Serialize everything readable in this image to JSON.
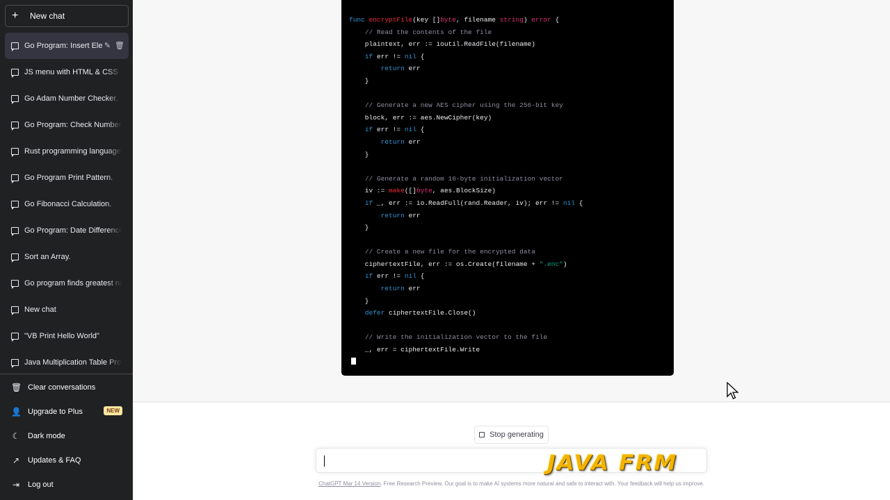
{
  "sidebar": {
    "new_chat": "New chat",
    "conversations": [
      {
        "title": "Go Program: Insert Ele",
        "active": true
      },
      {
        "title": "JS menu with HTML & CSS"
      },
      {
        "title": "Go Adam Number Checker."
      },
      {
        "title": "Go Program: Check Number"
      },
      {
        "title": "Rust programming language."
      },
      {
        "title": "Go Program Print Pattern."
      },
      {
        "title": "Go Fibonacci Calculation."
      },
      {
        "title": "Go Program: Date Difference."
      },
      {
        "title": "Sort an Array."
      },
      {
        "title": "Go program finds greatest nu"
      },
      {
        "title": "New chat"
      },
      {
        "title": "\"VB Print Hello World\""
      },
      {
        "title": "Java Multiplication Table Progr"
      }
    ],
    "bottom": {
      "clear": "Clear conversations",
      "upgrade": "Upgrade to Plus",
      "upgrade_badge": "NEW",
      "dark_mode": "Dark mode",
      "updates": "Updates & FAQ",
      "logout": "Log out"
    }
  },
  "code": {
    "language": "go",
    "lines": [
      "func encryptFile(key []byte, filename string) error {",
      "    // Read the contents of the file",
      "    plaintext, err := ioutil.ReadFile(filename)",
      "    if err != nil {",
      "        return err",
      "    }",
      "",
      "    // Generate a new AES cipher using the 256-bit key",
      "    block, err := aes.NewCipher(key)",
      "    if err != nil {",
      "        return err",
      "    }",
      "",
      "    // Generate a random 16-byte initialization vector",
      "    iv := make([]byte, aes.BlockSize)",
      "    if _, err := io.ReadFull(rand.Reader, iv); err != nil {",
      "        return err",
      "    }",
      "",
      "    // Create a new file for the encrypted data",
      "    ciphertextFile, err := os.Create(filename + \".enc\")",
      "    if err != nil {",
      "        return err",
      "    }",
      "    defer ciphertextFile.Close()",
      "",
      "    // Write the initialization vector to the file",
      "    _, err = ciphertextFile.Write"
    ]
  },
  "composer": {
    "stop_label": "Stop generating",
    "input_value": ""
  },
  "footer": {
    "version_link": "ChatGPT Mar 14 Version",
    "text": ". Free Research Preview. Our goal is to make AI systems more natural and safe to interact with. Your feedback will help us improve."
  },
  "watermark": "JAVA FRM",
  "colors": {
    "sidebar_bg": "#202123",
    "code_bg": "#000000",
    "keyword": "#2e95d3",
    "function": "#f22c3d",
    "type": "#df3079",
    "comment": "#8e8ea0",
    "string": "#00a67d"
  }
}
